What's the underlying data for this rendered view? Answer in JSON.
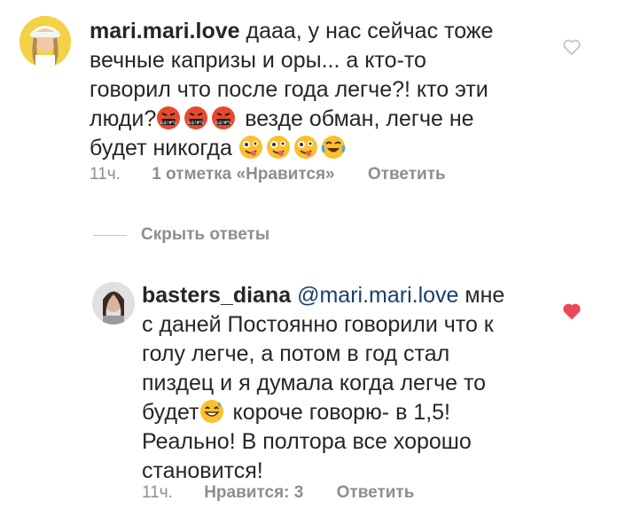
{
  "comments": [
    {
      "username": "mari.mari.love",
      "text_lines": [
        "дааа, у нас сейчас тоже",
        "вечные капризы и оры... а кто-то",
        "говорил что после года легче?! кто эти",
        "люди?",
        "везде обман, легче не",
        "будет никогда"
      ],
      "time": "11ч.",
      "likes": "1 отметка «Нравится»",
      "reply": "Ответить",
      "liked": false,
      "emojis_after_people": [
        "swearing-face-emoji",
        "swearing-face-emoji",
        "swearing-face-emoji"
      ],
      "emojis_end": [
        "zany-face-emoji",
        "zany-face-emoji",
        "zany-face-emoji",
        "tears-of-joy-emoji"
      ]
    },
    {
      "username": "basters_diana",
      "mention": "@mari.mari.love",
      "text_lines": [
        "мне",
        "с даней Постоянно говорили что к",
        "голу легче, а потом в год стал",
        "пиздец и я думала когда легче то",
        "будет",
        "короче говорю- в 1,5!",
        "Реально! В полтора все хорошо",
        "становится!"
      ],
      "time": "11ч.",
      "likes": "Нравится: 3",
      "reply": "Ответить",
      "liked": true,
      "emoji_inline": "grinning-sweat-emoji"
    }
  ],
  "hide_replies": "Скрыть ответы",
  "colors": {
    "heart_outline": "#c7c7c7",
    "heart_filled": "#ed4956",
    "meta_text": "#8e8e8e",
    "mention": "#1a3f6e"
  }
}
